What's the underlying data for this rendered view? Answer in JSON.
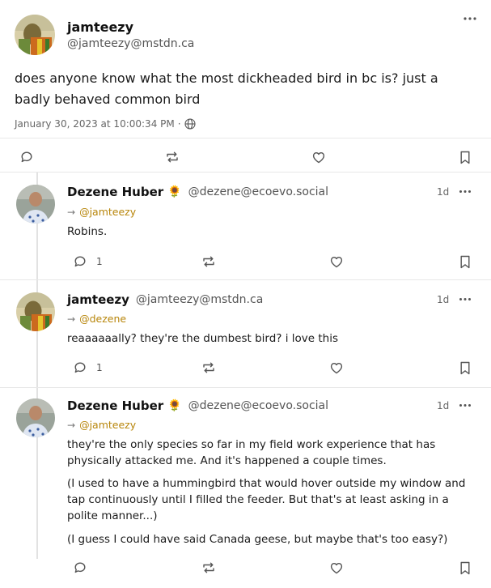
{
  "main_post": {
    "display_name": "jamteezy",
    "handle": "@jamteezy@mstdn.ca",
    "text": "does anyone know what the most dickheaded bird in bc is? just a badly behaved common bird",
    "timestamp": "January 30, 2023 at 10:00:34 PM"
  },
  "replies": [
    {
      "display_name": "Dezene Huber",
      "emoji": "🌻",
      "handle": "@dezene@ecoevo.social",
      "age": "1d",
      "mention": "@jamteezy",
      "paragraphs": [
        "Robins."
      ],
      "reply_count": "1"
    },
    {
      "display_name": "jamteezy",
      "emoji": "",
      "handle": "@jamteezy@mstdn.ca",
      "age": "1d",
      "mention": "@dezene",
      "paragraphs": [
        "reaaaaaally? they're the dumbest bird? i love this"
      ],
      "reply_count": "1"
    },
    {
      "display_name": "Dezene Huber",
      "emoji": "🌻",
      "handle": "@dezene@ecoevo.social",
      "age": "1d",
      "mention": "@jamteezy",
      "paragraphs": [
        "they're the only species so far in my field work experience that has physically attacked me. And it's happened a couple times.",
        "(I used to have a hummingbird that would hover outside my window and tap continuously until I filled the feeder. But that's at least asking in a polite manner...)",
        "(I guess I could have said Canada geese, but maybe that's too easy?)"
      ],
      "reply_count": ""
    }
  ],
  "icons": {
    "more": "more-dots-icon",
    "reply": "reply-bubble-icon",
    "boost": "boost-repeat-icon",
    "favourite": "heart-icon",
    "bookmark": "bookmark-icon",
    "visibility": "globe-icon",
    "mention_arrow": "arrow-right-icon"
  },
  "colors": {
    "mention": "#b8860b",
    "muted": "#666666"
  }
}
